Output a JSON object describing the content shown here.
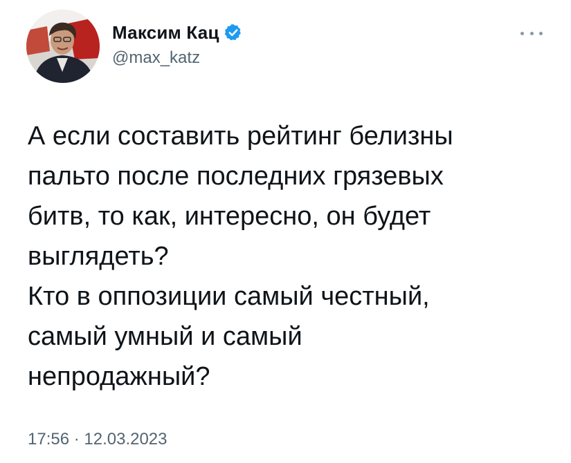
{
  "author": {
    "display_name": "Максим Кац",
    "handle": "@max_katz",
    "verified": true,
    "verified_color": "#1d9bf0",
    "avatar_icon": "profile-photo"
  },
  "menu": {
    "icon": "more-horizontal-icon"
  },
  "tweet": {
    "lines": [
      "А если составить рейтинг белизны",
      "пальто после последних грязевых",
      "битв, то как, интересно, он будет",
      "выглядеть?",
      "Кто в оппозиции самый честный,",
      "самый умный и самый",
      "непродажный?"
    ]
  },
  "meta": {
    "timestamp": "17:56 · 12.03.2023"
  }
}
